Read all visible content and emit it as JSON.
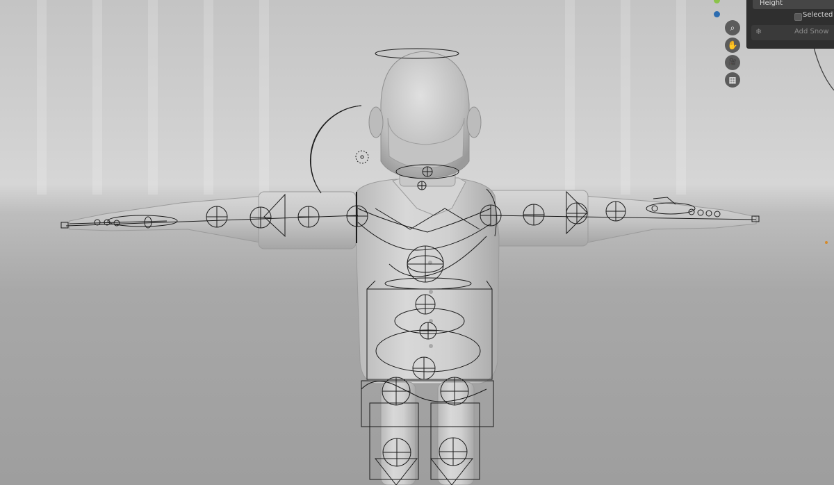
{
  "redo_panel": {
    "field_label": "Height",
    "checkbox_label": "Selected Fa",
    "checkbox_checked": false,
    "action_label": "Add Snow"
  },
  "navigation_gizmo": {
    "buttons": [
      {
        "name": "zoom-icon",
        "glyph": "⌕"
      },
      {
        "name": "pan-hand-icon",
        "glyph": "✋"
      },
      {
        "name": "camera-icon",
        "glyph": "🎥"
      },
      {
        "name": "grid-icon",
        "glyph": "▦"
      }
    ],
    "axis_colors": {
      "y_axis": "#8bc34a",
      "z_axis": "#2c6cb0"
    }
  },
  "scene": {
    "background_top": "#c4c4c4",
    "background_bottom": "#9e9e9e",
    "mesh_color": "#cfcfcf",
    "rig_color": "#1a1a1a",
    "light_marker_color": "#d58a2a"
  }
}
